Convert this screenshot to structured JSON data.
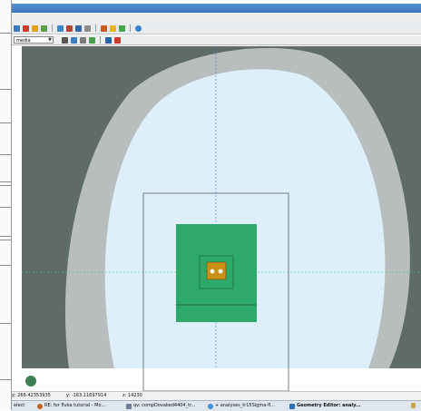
{
  "toolbar": {
    "mode_select": "media",
    "row1_icons": [
      "flair-logo-icon",
      "run-icon",
      "geometry-icon",
      "data-icon",
      "plot-icon",
      "paste-icon",
      "fluka-icon",
      "settings-icon",
      "cut-icon",
      "object-icon",
      "check-icon",
      "globe-icon"
    ],
    "row2_icons": [
      "select-icon",
      "zoom-icon",
      "pan-icon",
      "rotate-icon",
      "pencil-icon",
      "color-icon"
    ]
  },
  "viewport": {
    "colors": {
      "background": "#5e6b67",
      "tunnel_wall": "#b8bdbd",
      "tunnel_air": "#dceffa",
      "floor": "#ffffff",
      "block": "#2ea96a",
      "target": "#c79117",
      "gridline": "#39d36a",
      "vertical_gridline": "#4a7fd4"
    }
  },
  "status": {
    "x": "x: 266.42353935",
    "y": "y: -163.11697914",
    "z": "z: 14230",
    "mode": "elect"
  },
  "taskbar": {
    "items": [
      {
        "label": "RE: for fluka tutorial - Mo...",
        "icon_color": "#c8621f"
      },
      {
        "label": "qv: compDovaked4404_tr...",
        "icon_color": "#6f7f93"
      },
      {
        "label": "+ analyses_tr15Sigma-fl...",
        "icon_color": "#4d8bd6"
      },
      {
        "label": "Geometry Editor: analy...",
        "icon_color": "#2f6fb5"
      }
    ]
  }
}
